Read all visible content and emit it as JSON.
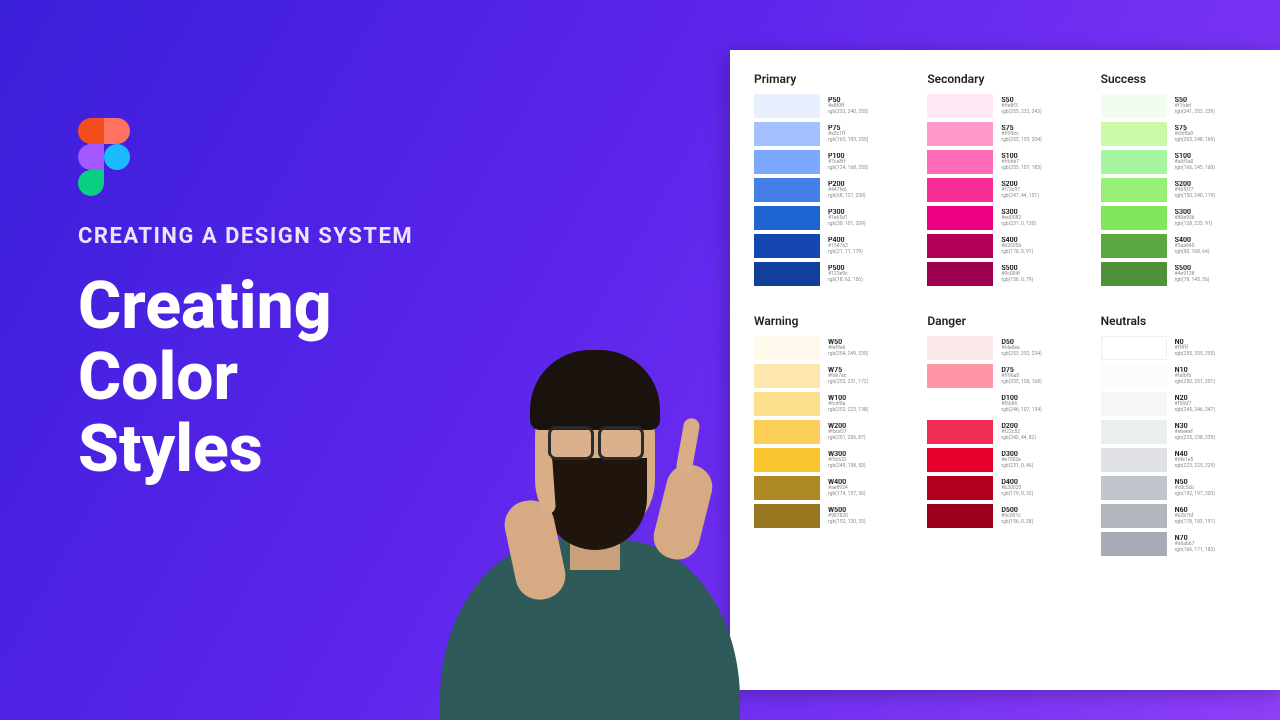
{
  "hero": {
    "subtitle": "CREATING A DESIGN SYSTEM",
    "title_line1": "Creating",
    "title_line2": "Color",
    "title_line3": "Styles"
  },
  "palette": {
    "row1": [
      {
        "title": "Primary",
        "swatches": [
          {
            "name": "P50",
            "hex": "#e8f0ff",
            "rgb": "rgb(232, 240, 255)"
          },
          {
            "name": "P75",
            "hex": "#a3c1ff",
            "rgb": "rgb(163, 193, 255)"
          },
          {
            "name": "P100",
            "hex": "#7ca8ff",
            "rgb": "rgb(124, 168, 255)"
          },
          {
            "name": "P200",
            "hex": "#447fe6",
            "rgb": "rgb(68, 127, 230)"
          },
          {
            "name": "P300",
            "hex": "#1e65d1",
            "rgb": "rgb(30, 101, 209)"
          },
          {
            "name": "P400",
            "hex": "#1547b3",
            "rgb": "rgb(21, 71, 179)"
          },
          {
            "name": "P500",
            "hex": "#123e9c",
            "rgb": "rgb(18, 62, 156)"
          }
        ]
      },
      {
        "title": "Secondary",
        "swatches": [
          {
            "name": "S50",
            "hex": "#ffe8f3",
            "rgb": "rgb(255, 232, 243)"
          },
          {
            "name": "S75",
            "hex": "#ff99cc",
            "rgb": "rgb(255, 153, 204)"
          },
          {
            "name": "S100",
            "hex": "#ff6bb7",
            "rgb": "rgb(255, 107, 183)"
          },
          {
            "name": "S200",
            "hex": "#f72c97",
            "rgb": "rgb(247, 44, 151)"
          },
          {
            "name": "S300",
            "hex": "#ed0082",
            "rgb": "rgb(237, 0, 130)"
          },
          {
            "name": "S400",
            "hex": "#b2005b",
            "rgb": "rgb(178, 0, 91)"
          },
          {
            "name": "S500",
            "hex": "#9c004f",
            "rgb": "rgb(156, 0, 79)"
          }
        ]
      },
      {
        "title": "Success",
        "swatches": [
          {
            "name": "S50",
            "hex": "#f1fdef",
            "rgb": "rgb(241, 253, 239)"
          },
          {
            "name": "S75",
            "hex": "#cbf8a9",
            "rgb": "rgb(203, 248, 169)"
          },
          {
            "name": "S100",
            "hex": "#a6f5a0",
            "rgb": "rgb(166, 245, 160)"
          },
          {
            "name": "S200",
            "hex": "#96f077",
            "rgb": "rgb(150, 240, 119)"
          },
          {
            "name": "S300",
            "hex": "#80e95b",
            "rgb": "rgb(128, 233, 91)"
          },
          {
            "name": "S400",
            "hex": "#5aa840",
            "rgb": "rgb(90, 168, 64)"
          },
          {
            "name": "S500",
            "hex": "#4e9138",
            "rgb": "rgb(78, 145, 56)"
          }
        ]
      }
    ],
    "row2": [
      {
        "title": "Warning",
        "swatches": [
          {
            "name": "W50",
            "hex": "#fef9eb",
            "rgb": "rgb(254, 249, 235)"
          },
          {
            "name": "W75",
            "hex": "#fde7ac",
            "rgb": "rgb(253, 231, 172)"
          },
          {
            "name": "W100",
            "hex": "#fcdf8a",
            "rgb": "rgb(252, 223, 138)"
          },
          {
            "name": "W200",
            "hex": "#fbce57",
            "rgb": "rgb(251, 206, 87)"
          },
          {
            "name": "W300",
            "hex": "#f9c632",
            "rgb": "rgb(249, 198, 50)"
          },
          {
            "name": "W400",
            "hex": "#ae8924",
            "rgb": "rgb(174, 137, 36)"
          },
          {
            "name": "W500",
            "hex": "#987820",
            "rgb": "rgb(152, 120, 32)"
          }
        ]
      },
      {
        "title": "Danger",
        "swatches": [
          {
            "name": "D50",
            "hex": "#fde8ea",
            "rgb": "rgb(253, 232, 234)"
          },
          {
            "name": "D75",
            "hex": "#ff96a8",
            "rgb": "rgb(255, 150, 168)"
          },
          {
            "name": "D100",
            "hex": "#f6b86",
            "rgb": "rgb(246, 107, 134)"
          },
          {
            "name": "D200",
            "hex": "#f22c52",
            "rgb": "rgb(242, 44, 82)"
          },
          {
            "name": "D300",
            "hex": "#e7002e",
            "rgb": "rgb(231, 0, 46)"
          },
          {
            "name": "D400",
            "hex": "#b30020",
            "rgb": "rgb(179, 0, 32)"
          },
          {
            "name": "D500",
            "hex": "#9c001c",
            "rgb": "rgb(156, 0, 28)"
          }
        ]
      },
      {
        "title": "Neutrals",
        "swatches": [
          {
            "name": "N0",
            "hex": "#ffffff",
            "rgb": "rgb(255, 255, 255)"
          },
          {
            "name": "N10",
            "hex": "#fafbfb",
            "rgb": "rgb(250, 251, 251)"
          },
          {
            "name": "N20",
            "hex": "#f5f6f7",
            "rgb": "rgb(245, 246, 247)"
          },
          {
            "name": "N30",
            "hex": "#ebeeef",
            "rgb": "rgb(235, 238, 239)"
          },
          {
            "name": "N40",
            "hex": "#dfe1e5",
            "rgb": "rgb(223, 225, 229)"
          },
          {
            "name": "N50",
            "hex": "#c0c5cb",
            "rgb": "rgb(192, 197, 203)"
          },
          {
            "name": "N60",
            "hex": "#b2b7bf",
            "rgb": "rgb(178, 183, 191)"
          },
          {
            "name": "N70",
            "hex": "#a6abb7",
            "rgb": "rgb(166, 171, 183)"
          }
        ]
      }
    ]
  }
}
